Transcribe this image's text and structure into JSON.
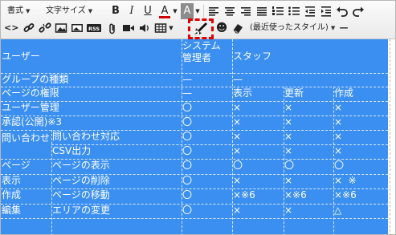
{
  "toolbar": {
    "format_label": "書式",
    "fontsize_label": "文字サイズ",
    "bold_label": "B",
    "italic_label": "I",
    "underline_label": "U",
    "textcolor_label": "A",
    "bgcolor_label": "A",
    "styles_label": "(最近使ったスタイル)",
    "hr_label": "—",
    "colors": {
      "accent_highlight": "#e00000",
      "text_color_bar": "#d00000"
    }
  },
  "table": {
    "rows": [
      [
        "ユーザー",
        "",
        "システム\n管理者",
        "スタッフ",
        "",
        ""
      ],
      [
        "グループの種類",
        "",
        "—",
        "—",
        "",
        ""
      ],
      [
        "ページの権限",
        "",
        "—",
        "表示",
        "更新",
        "作成"
      ],
      [
        "ユーザー管理",
        "",
        "〇",
        "×",
        "×",
        "×"
      ],
      [
        "承認(公開)※3",
        "",
        "〇",
        "×",
        "×",
        "×"
      ],
      [
        "問い合わせ",
        "問い合わせ対応",
        "〇",
        "×",
        "×",
        "×"
      ],
      [
        "",
        "CSV出力",
        "〇",
        "×",
        "×",
        "×"
      ],
      [
        "ページ",
        "ページの表示",
        "〇",
        "〇",
        "〇",
        "〇"
      ],
      [
        "表示",
        "ページの削除",
        "〇",
        "×",
        "×",
        "×  ※"
      ],
      [
        "作成",
        "ページの移動",
        "〇",
        "×※6",
        "×※6",
        "×※6"
      ],
      [
        "編集",
        "エリアの変更",
        "〇",
        "×",
        "×",
        "△"
      ]
    ],
    "colors": {
      "selection_bg": "#3a8ff0",
      "text": "#ffffff"
    }
  }
}
